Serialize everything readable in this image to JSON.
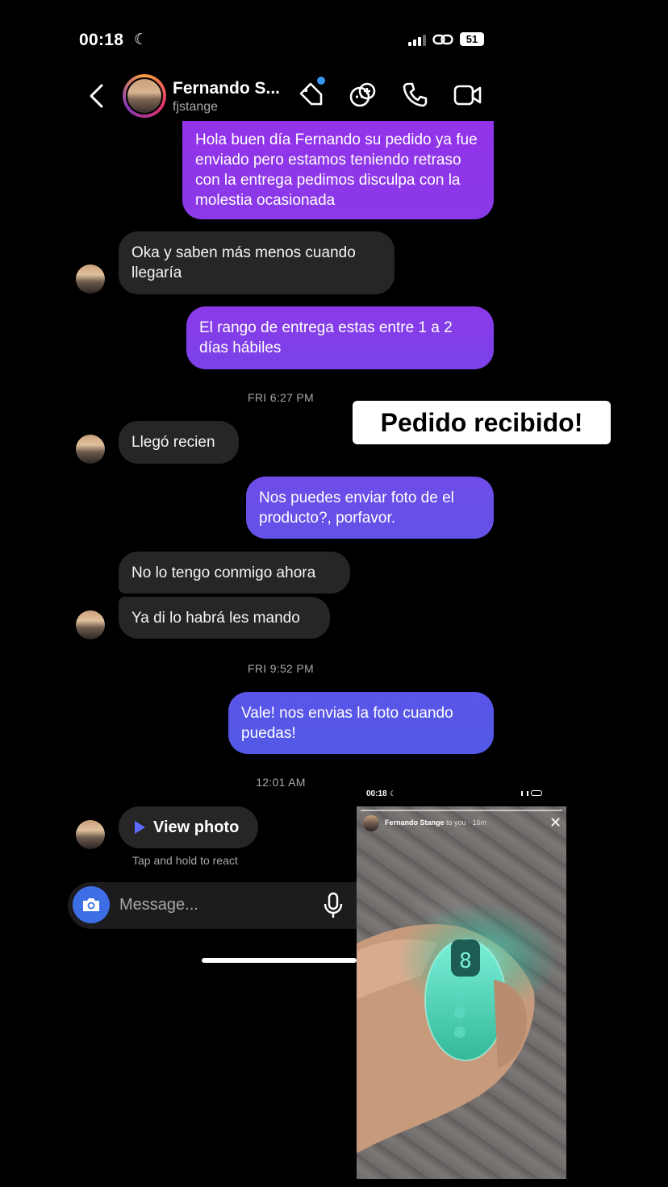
{
  "status_bar": {
    "time": "00:18",
    "battery": "51"
  },
  "header": {
    "name": "Fernando S...",
    "username": "fjstange"
  },
  "messages": [
    {
      "dir": "out",
      "text": "Hola buen día Fernando su pedido ya fue enviado pero estamos teniendo retraso con la entrega pedimos disculpa con la molestia ocasionada"
    },
    {
      "dir": "in",
      "text": "Oka y saben más menos cuando llegaría"
    },
    {
      "dir": "out",
      "text": "El rango de entrega estas entre 1 a 2 días hábiles"
    },
    {
      "dir": "in",
      "text": "Llegó recien"
    },
    {
      "dir": "out",
      "text": "Nos puedes enviar foto de el producto?, porfavor."
    },
    {
      "dir": "in",
      "text": "No lo tengo conmigo ahora"
    },
    {
      "dir": "in",
      "text": "Ya di lo habrá les mando"
    },
    {
      "dir": "out",
      "text": "Vale! nos envias la foto cuando puedas!"
    }
  ],
  "timestamps": [
    "FRI 6:27 PM",
    "FRI 9:52 PM",
    "12:01 AM"
  ],
  "sticker": "Pedido recibido!",
  "view_photo": {
    "label": "View photo",
    "hint": "Tap and hold to react"
  },
  "composer": {
    "placeholder": "Message..."
  },
  "story": {
    "time": "00:18",
    "author": "Fernando Stange",
    "meta": "to you · 16m"
  },
  "colors": {
    "bubble_out_top": "#8a3ae8",
    "bubble_out_bottom": "#5a5ae6",
    "bubble_in": "#262626",
    "accent": "#3d6ee6"
  }
}
